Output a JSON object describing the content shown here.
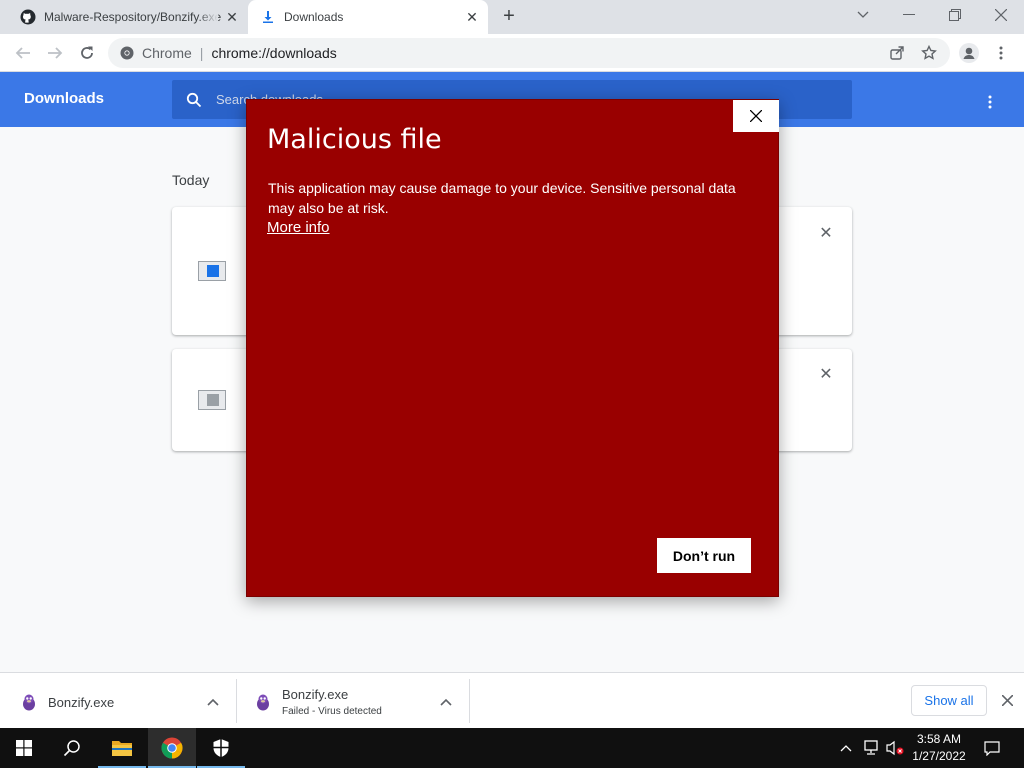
{
  "tabs": [
    {
      "title": "Malware-Respository/Bonzify.exe",
      "favicon": "github-icon",
      "active": false
    },
    {
      "title": "Downloads",
      "favicon": "download-icon",
      "active": true
    }
  ],
  "toolbar": {
    "chip": "Chrome",
    "url": "chrome://downloads"
  },
  "downloads_page": {
    "title": "Downloads",
    "search_placeholder": "Search downloads",
    "section_date": "Today"
  },
  "modal": {
    "title": "Malicious file",
    "body": "This application may cause damage to your device. Sensitive personal data may also be at risk.",
    "link": "More info",
    "button": "Don’t run",
    "background": "#990000"
  },
  "shelf": {
    "items": [
      {
        "name": "Bonzify.exe",
        "status": ""
      },
      {
        "name": "Bonzify.exe",
        "status": "Failed - Virus detected"
      }
    ],
    "show_all": "Show all"
  },
  "taskbar": {
    "time": "3:58 AM",
    "date": "1/27/2022"
  },
  "colors": {
    "accent": "#3b78e7",
    "modal_red": "#990000",
    "link_blue": "#1a73e8"
  }
}
